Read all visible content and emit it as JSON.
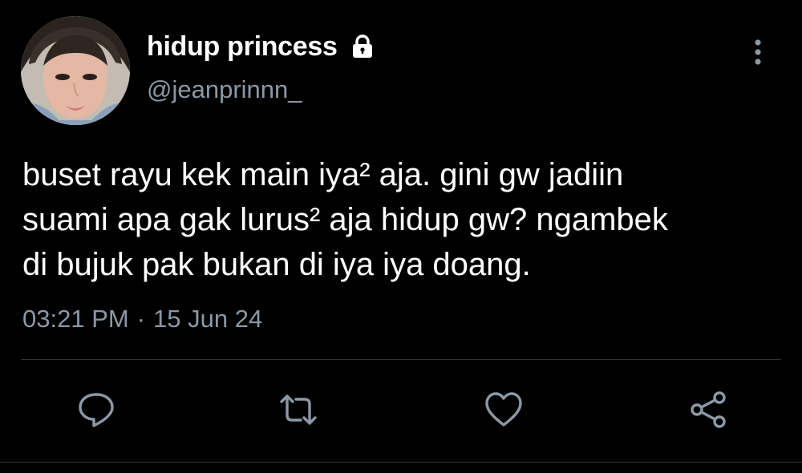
{
  "author": {
    "display_name": "hidup princess",
    "handle": "@jeanprinnn_",
    "avatar": "profile-photo",
    "protected_icon": "lock-icon"
  },
  "more_icon": "more-vertical-icon",
  "tweet": {
    "text": "buset rayu kek main iya² aja. gini gw jadiin\nsuami apa gak lurus² aja hidup gw? ngambek\ndi bujuk pak bukan di iya iya doang.",
    "time": "03:21 PM",
    "separator": "·",
    "date": "15 Jun 24"
  },
  "actions": [
    {
      "name": "reply",
      "icon": "reply-icon"
    },
    {
      "name": "retweet",
      "icon": "retweet-icon"
    },
    {
      "name": "like",
      "icon": "heart-icon"
    },
    {
      "name": "share",
      "icon": "share-icon"
    }
  ],
  "colors": {
    "background": "#000000",
    "text_primary": "#ffffff",
    "text_secondary": "#8b98a5",
    "divider": "#2f3336"
  }
}
